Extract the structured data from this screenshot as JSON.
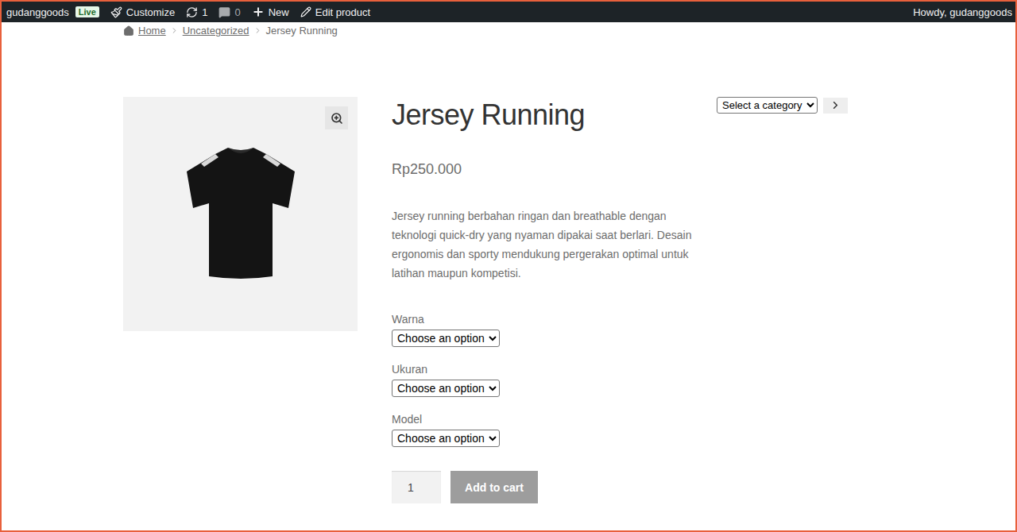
{
  "admin_bar": {
    "site": "gudanggoods",
    "badge": "Live",
    "customize": "Customize",
    "updates": "1",
    "comments": "0",
    "new": "New",
    "edit": "Edit product",
    "greeting": "Howdy, gudanggoods"
  },
  "breadcrumb": [
    {
      "label": "Home",
      "link": true
    },
    {
      "label": "Uncategorized",
      "link": true
    },
    {
      "label": "Jersey Running",
      "link": false
    }
  ],
  "product": {
    "title": "Jersey Running",
    "price": "Rp250.000",
    "description": "Jersey running berbahan ringan dan breathable dengan teknologi quick-dry yang nyaman dipakai saat berlari. Desain ergonomis dan sporty mendukung pergerakan optimal untuk latihan maupun kompetisi.",
    "variations": [
      {
        "label": "Warna",
        "value": "Choose an option"
      },
      {
        "label": "Ukuran",
        "value": "Choose an option"
      },
      {
        "label": "Model",
        "value": "Choose an option"
      }
    ],
    "quantity": "1",
    "add_to_cart": {
      "label": "Add to cart",
      "disabled": true
    }
  },
  "sidebar": {
    "category_select": "Select a category"
  }
}
